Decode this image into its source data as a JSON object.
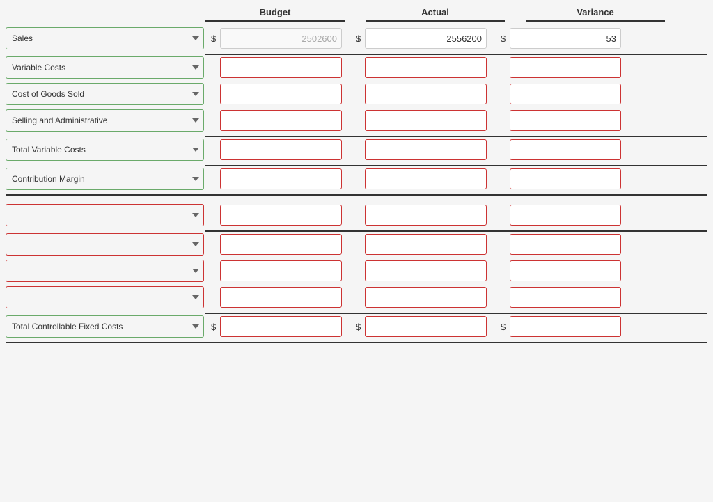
{
  "headers": {
    "budget": "Budget",
    "actual": "Actual",
    "variance": "Variance"
  },
  "rows": [
    {
      "id": "sales",
      "label": "Sales",
      "type": "header-row",
      "borderClass": "green-border",
      "showDollar": true,
      "budget": "2502600",
      "actual": "2556200",
      "variance": "53",
      "budgetPlaceholder": "2502600",
      "budgetReadonly": true,
      "actualReadonly": true
    },
    {
      "id": "variable-costs",
      "label": "Variable Costs",
      "type": "section-label",
      "borderClass": "green-border",
      "showDollar": false,
      "budget": "",
      "actual": "",
      "variance": ""
    },
    {
      "id": "cost-of-goods-sold",
      "label": "Cost of Goods Sold",
      "type": "data",
      "borderClass": "green-border",
      "showDollar": false,
      "budget": "",
      "actual": "",
      "variance": ""
    },
    {
      "id": "selling-admin",
      "label": "Selling and Administrative",
      "type": "data",
      "borderClass": "green-border",
      "showDollar": false,
      "budget": "",
      "actual": "",
      "variance": ""
    },
    {
      "id": "total-variable-costs",
      "label": "Total Variable Costs",
      "type": "data",
      "borderClass": "green-border",
      "showDollar": false,
      "budget": "",
      "actual": "",
      "variance": ""
    },
    {
      "id": "contribution-margin",
      "label": "Contribution Margin",
      "type": "data",
      "borderClass": "green-border",
      "showDollar": false,
      "budget": "",
      "actual": "",
      "variance": ""
    },
    {
      "id": "empty-1",
      "label": "",
      "type": "data",
      "borderClass": "red-border",
      "showDollar": false,
      "budget": "",
      "actual": "",
      "variance": ""
    },
    {
      "id": "empty-2",
      "label": "",
      "type": "data",
      "borderClass": "red-border",
      "showDollar": false,
      "budget": "",
      "actual": "",
      "variance": ""
    },
    {
      "id": "empty-3",
      "label": "",
      "type": "data",
      "borderClass": "red-border",
      "showDollar": false,
      "budget": "",
      "actual": "",
      "variance": ""
    },
    {
      "id": "empty-4",
      "label": "",
      "type": "data",
      "borderClass": "red-border",
      "showDollar": false,
      "budget": "",
      "actual": "",
      "variance": ""
    },
    {
      "id": "total-controllable-fixed",
      "label": "Total Controllable Fixed Costs",
      "type": "total",
      "borderClass": "green-border",
      "showDollar": true,
      "budget": "",
      "actual": "",
      "variance": ""
    }
  ]
}
